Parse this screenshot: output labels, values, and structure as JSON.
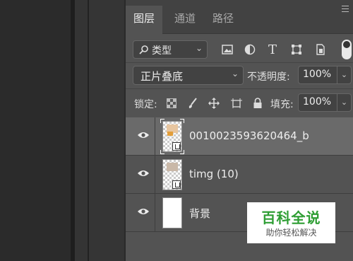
{
  "tabs": [
    {
      "label": "图层",
      "active": true
    },
    {
      "label": "通道",
      "active": false
    },
    {
      "label": "路径",
      "active": false
    }
  ],
  "filter": {
    "label": "类型",
    "icons": [
      "image-filter-icon",
      "adjustment-filter-icon",
      "type-filter-icon",
      "shape-filter-icon",
      "smart-object-filter-icon"
    ]
  },
  "blend_mode": "正片叠底",
  "opacity": {
    "label": "不透明度:",
    "value": "100%"
  },
  "lock": {
    "label": "锁定:"
  },
  "fill": {
    "label": "填充:",
    "value": "100%"
  },
  "layers": [
    {
      "name": "0010023593620464_b",
      "selected": true,
      "visible": true
    },
    {
      "name": "timg (10)",
      "selected": false,
      "visible": true
    },
    {
      "name": "背景",
      "selected": false,
      "visible": true
    }
  ],
  "watermark": {
    "title": "百科全说",
    "subtitle": "助你轻松解决"
  }
}
